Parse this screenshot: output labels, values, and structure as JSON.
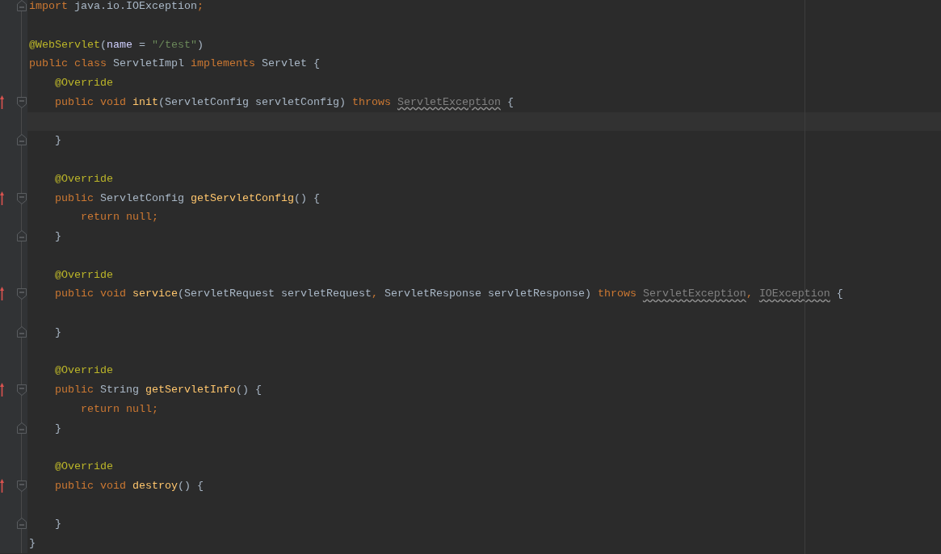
{
  "editor": {
    "lines": [
      {
        "overrides": false,
        "current": false,
        "fold_start": false,
        "fold_end": true,
        "tokens": [
          {
            "text": "import",
            "kind": "keyword"
          },
          {
            "text": " java.io.IOException",
            "kind": "plain"
          },
          {
            "text": ";",
            "kind": "keyword"
          }
        ]
      },
      {
        "overrides": false,
        "current": false,
        "fold_start": false,
        "fold_end": false
      },
      {
        "overrides": false,
        "current": false,
        "fold_start": false,
        "fold_end": false,
        "tokens": [
          {
            "text": "@WebServlet",
            "kind": "annotation"
          },
          {
            "text": "(",
            "kind": "plain"
          },
          {
            "text": "name",
            "kind": "param"
          },
          {
            "text": " = ",
            "kind": "plain"
          },
          {
            "text": "\"/test\"",
            "kind": "string"
          },
          {
            "text": ")",
            "kind": "plain"
          }
        ]
      },
      {
        "overrides": false,
        "current": false,
        "fold_start": false,
        "fold_end": false,
        "tokens": [
          {
            "text": "public class ",
            "kind": "keyword"
          },
          {
            "text": "ServletImpl ",
            "kind": "plain"
          },
          {
            "text": "implements ",
            "kind": "keyword"
          },
          {
            "text": "Servlet {",
            "kind": "plain"
          }
        ]
      },
      {
        "overrides": false,
        "current": false,
        "fold_start": false,
        "fold_end": false,
        "tokens": [
          {
            "text": "    @Override",
            "kind": "annotation"
          }
        ]
      },
      {
        "overrides": true,
        "current": false,
        "fold_start": true,
        "fold_end": false,
        "tokens": [
          {
            "text": "    public void ",
            "kind": "keyword"
          },
          {
            "text": "init",
            "kind": "method"
          },
          {
            "text": "(ServletConfig servletConfig) ",
            "kind": "plain"
          },
          {
            "text": "throws ",
            "kind": "keyword"
          },
          {
            "text": "ServletException",
            "kind": "warning"
          },
          {
            "text": " {",
            "kind": "plain"
          }
        ]
      },
      {
        "overrides": false,
        "current": true,
        "fold_start": false,
        "fold_end": false
      },
      {
        "overrides": false,
        "current": false,
        "fold_start": false,
        "fold_end": true,
        "tokens": [
          {
            "text": "    }",
            "kind": "plain"
          }
        ]
      },
      {
        "overrides": false,
        "current": false,
        "fold_start": false,
        "fold_end": false
      },
      {
        "overrides": false,
        "current": false,
        "fold_start": false,
        "fold_end": false,
        "tokens": [
          {
            "text": "    @Override",
            "kind": "annotation"
          }
        ]
      },
      {
        "overrides": true,
        "current": false,
        "fold_start": true,
        "fold_end": false,
        "tokens": [
          {
            "text": "    public ",
            "kind": "keyword"
          },
          {
            "text": "ServletConfig ",
            "kind": "plain"
          },
          {
            "text": "getServletConfig",
            "kind": "method"
          },
          {
            "text": "() {",
            "kind": "plain"
          }
        ]
      },
      {
        "overrides": false,
        "current": false,
        "fold_start": false,
        "fold_end": false,
        "tokens": [
          {
            "text": "        return null",
            "kind": "keyword"
          },
          {
            "text": ";",
            "kind": "keyword"
          }
        ]
      },
      {
        "overrides": false,
        "current": false,
        "fold_start": false,
        "fold_end": true,
        "tokens": [
          {
            "text": "    }",
            "kind": "plain"
          }
        ]
      },
      {
        "overrides": false,
        "current": false,
        "fold_start": false,
        "fold_end": false
      },
      {
        "overrides": false,
        "current": false,
        "fold_start": false,
        "fold_end": false,
        "tokens": [
          {
            "text": "    @Override",
            "kind": "annotation"
          }
        ]
      },
      {
        "overrides": true,
        "current": false,
        "fold_start": true,
        "fold_end": false,
        "tokens": [
          {
            "text": "    public void ",
            "kind": "keyword"
          },
          {
            "text": "service",
            "kind": "method"
          },
          {
            "text": "(ServletRequest servletRequest",
            "kind": "plain"
          },
          {
            "text": ",",
            "kind": "keyword"
          },
          {
            "text": " ServletResponse servletResponse) ",
            "kind": "plain"
          },
          {
            "text": "throws ",
            "kind": "keyword"
          },
          {
            "text": "ServletException",
            "kind": "warning"
          },
          {
            "text": ", ",
            "kind": "keyword"
          },
          {
            "text": "IOException",
            "kind": "warning"
          },
          {
            "text": " {",
            "kind": "plain"
          }
        ]
      },
      {
        "overrides": false,
        "current": false,
        "fold_start": false,
        "fold_end": false
      },
      {
        "overrides": false,
        "current": false,
        "fold_start": false,
        "fold_end": true,
        "tokens": [
          {
            "text": "    }",
            "kind": "plain"
          }
        ]
      },
      {
        "overrides": false,
        "current": false,
        "fold_start": false,
        "fold_end": false
      },
      {
        "overrides": false,
        "current": false,
        "fold_start": false,
        "fold_end": false,
        "tokens": [
          {
            "text": "    @Override",
            "kind": "annotation"
          }
        ]
      },
      {
        "overrides": true,
        "current": false,
        "fold_start": true,
        "fold_end": false,
        "tokens": [
          {
            "text": "    public ",
            "kind": "keyword"
          },
          {
            "text": "String ",
            "kind": "plain"
          },
          {
            "text": "getServletInfo",
            "kind": "method"
          },
          {
            "text": "() {",
            "kind": "plain"
          }
        ]
      },
      {
        "overrides": false,
        "current": false,
        "fold_start": false,
        "fold_end": false,
        "tokens": [
          {
            "text": "        return null",
            "kind": "keyword"
          },
          {
            "text": ";",
            "kind": "keyword"
          }
        ]
      },
      {
        "overrides": false,
        "current": false,
        "fold_start": false,
        "fold_end": true,
        "tokens": [
          {
            "text": "    }",
            "kind": "plain"
          }
        ]
      },
      {
        "overrides": false,
        "current": false,
        "fold_start": false,
        "fold_end": false
      },
      {
        "overrides": false,
        "current": false,
        "fold_start": false,
        "fold_end": false,
        "tokens": [
          {
            "text": "    @Override",
            "kind": "annotation"
          }
        ]
      },
      {
        "overrides": true,
        "current": false,
        "fold_start": true,
        "fold_end": false,
        "tokens": [
          {
            "text": "    public void ",
            "kind": "keyword"
          },
          {
            "text": "destroy",
            "kind": "method"
          },
          {
            "text": "() {",
            "kind": "plain"
          }
        ]
      },
      {
        "overrides": false,
        "current": false,
        "fold_start": false,
        "fold_end": false
      },
      {
        "overrides": false,
        "current": false,
        "fold_start": false,
        "fold_end": true,
        "tokens": [
          {
            "text": "    }",
            "kind": "plain"
          }
        ]
      },
      {
        "overrides": false,
        "current": false,
        "fold_start": false,
        "fold_end": false,
        "tokens": [
          {
            "text": "}",
            "kind": "plain"
          }
        ]
      }
    ]
  }
}
